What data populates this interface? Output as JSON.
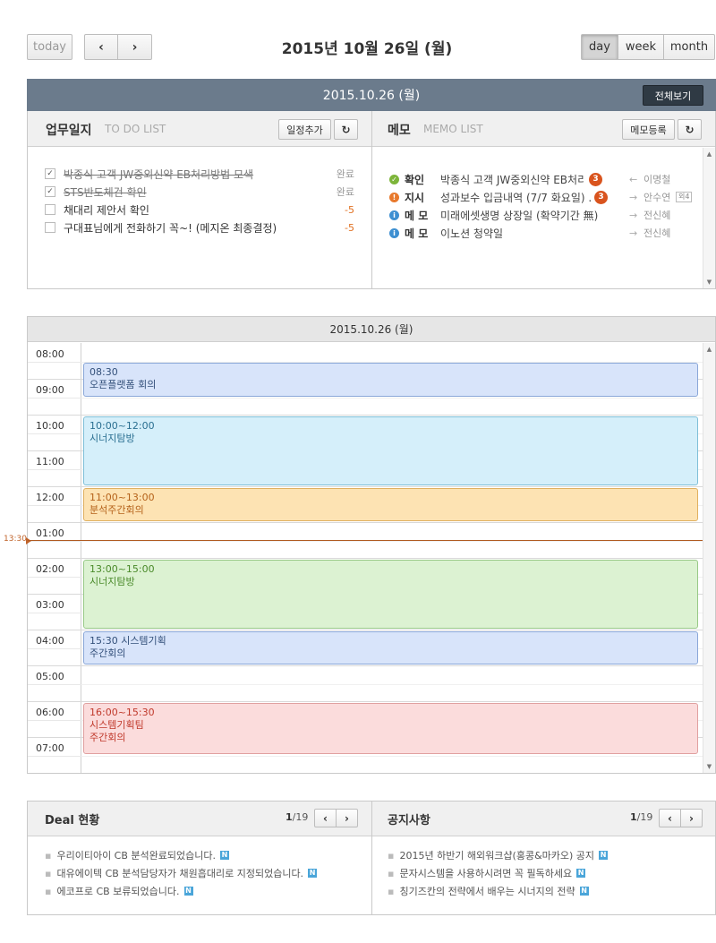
{
  "toolbar": {
    "today_label": "today",
    "prev_icon": "chevron-left-icon",
    "next_icon": "chevron-right-icon",
    "date_title": "2015년 10월 26일 (월)",
    "views": [
      "day",
      "week",
      "month"
    ],
    "active_view": "day"
  },
  "summary": {
    "date": "2015.10.26 (월)",
    "view_all_label": "전체보기"
  },
  "todo": {
    "title": "업무일지",
    "subtitle": "TO DO LIST",
    "add_label": "일정추가",
    "items": [
      {
        "text": "박종식 고객 JW중외신약 EB처리방법 모색",
        "status": "완료",
        "done": true
      },
      {
        "text": "STS반도체건 확인",
        "status": "완료",
        "done": true
      },
      {
        "text": "채대리 제안서 확인",
        "status": "-5",
        "done": false
      },
      {
        "text": "구대표님에게 전화하기 꼭~! (메지온 최종결정)",
        "status": "-5",
        "done": false
      }
    ]
  },
  "memo": {
    "title": "메모",
    "subtitle": "MEMO LIST",
    "add_label": "메모등록",
    "items": [
      {
        "type": "확인",
        "icon": "check-icon",
        "color": "#7db53a",
        "text": "박종식 고객 JW중외신약 EB처리",
        "badge": "3",
        "direction": "←",
        "person": "이명철"
      },
      {
        "type": "지시",
        "icon": "exclamation-icon",
        "color": "#e8792c",
        "text": "성과보수 입금내역 (7/7 화요일) ...",
        "badge": "3",
        "direction": "→",
        "person": "안수연",
        "extra": "외4"
      },
      {
        "type": "메 모",
        "icon": "info-icon",
        "color": "#3d8fd1",
        "text": "미래에셋생명 상장일 (확약기간 無)",
        "direction": "→",
        "person": "전신혜"
      },
      {
        "type": "메 모",
        "icon": "info-icon",
        "color": "#3d8fd1",
        "text": "이노션 청약일",
        "direction": "→",
        "person": "전신혜"
      }
    ]
  },
  "calendar": {
    "header": "2015.10.26 (월)",
    "time_labels": [
      "08:00",
      "09:00",
      "10:00",
      "11:00",
      "12:00",
      "01:00",
      "02:00",
      "03:00",
      "04:00",
      "05:00",
      "06:00",
      "07:00"
    ],
    "current_time": "13:30",
    "events": [
      {
        "time": "08:30",
        "title": "오픈플랫폼 회의",
        "bg": "#d8e4fa",
        "border": "#8aa7d8"
      },
      {
        "time": "10:00~12:00",
        "title": "시너지탐방",
        "bg": "#d5effa",
        "border": "#7fbfd8"
      },
      {
        "time": "11:00~13:00",
        "title": "분석주간회의",
        "bg": "#fde3b3",
        "border": "#e0b060",
        "color": "#b5621a"
      },
      {
        "time": "13:00~15:00",
        "title": "시너지탐방",
        "bg": "#dcf2d2",
        "border": "#98c987",
        "color": "#4a8a2a"
      },
      {
        "time": "15:30 시스템기획",
        "title": "주간회의",
        "bg": "#d8e4fa",
        "border": "#8aa7d8"
      },
      {
        "time": "16:00~15:30",
        "title": "시스템기획팀",
        "title2": "주간회의",
        "bg": "#fbdcdc",
        "border": "#e0a0a0",
        "color": "#c0392b"
      }
    ]
  },
  "deal": {
    "title": "Deal 현황",
    "page_current": "1",
    "page_total": "/19",
    "items": [
      "우리이티아이 CB 분석완료되었습니다.",
      "대유에이텍 CB 분석담당자가 채원흡대리로 지정되었습니다.",
      "에코프로 CB 보류되었습니다."
    ],
    "new_badge": "N"
  },
  "notice": {
    "title": "공지사항",
    "page_current": "1",
    "page_total": "/19",
    "items": [
      "2015년 하반기 해외워크샵(홍콩&마카오) 공지",
      "문자시스템을 사용하시려면 꼭 필독하세요",
      "칭기즈칸의 전략에서 배우는 시너지의 전략"
    ],
    "new_badge": "N"
  }
}
